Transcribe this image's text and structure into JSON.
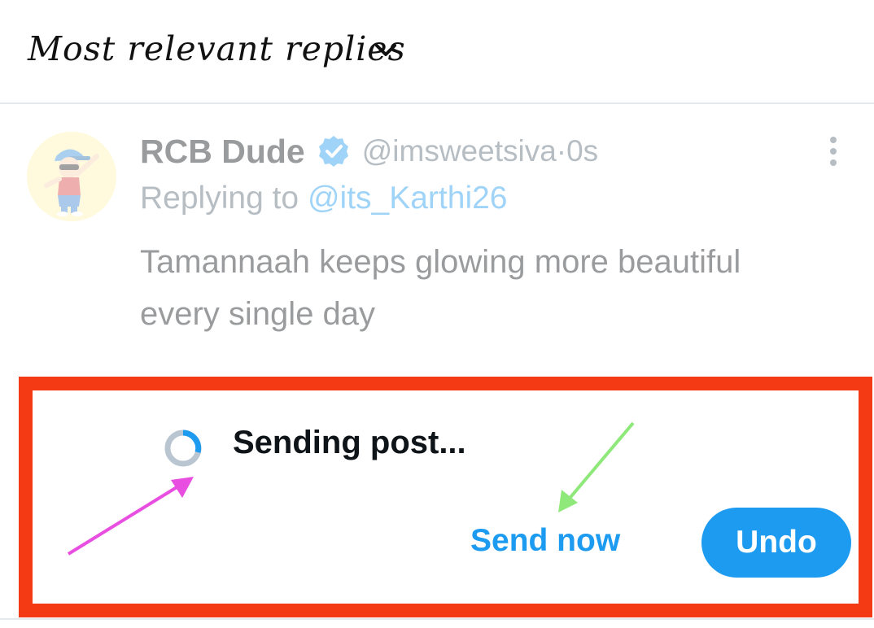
{
  "header": {
    "sort_label": "Most relevant replies",
    "sort_icon": "chevron-down-icon"
  },
  "tweet": {
    "display_name": "RCB Dude",
    "verified_icon": "verified-badge-icon",
    "handle": "@imsweetsiva",
    "time_separator": " · ",
    "time": "0s",
    "replying_prefix": "Replying to ",
    "replying_to": "@its_Karthi26",
    "text": "Tamannaah keeps glowing more beautiful every single day",
    "more_icon": "more-vertical-icon",
    "avatar_icon": "cartoon-dab-avatar"
  },
  "toast": {
    "status_text": "Sending post...",
    "spinner_icon": "loading-spinner-icon",
    "send_now_label": "Send now",
    "undo_label": "Undo"
  },
  "annotations": {
    "highlight_color": "#f33a15",
    "spinner_arrow_color": "#e84fe0",
    "send_now_arrow_color": "#8fe87a"
  },
  "colors": {
    "accent": "#1d9bf0",
    "text_primary": "#0f1419",
    "text_secondary": "#536471"
  }
}
